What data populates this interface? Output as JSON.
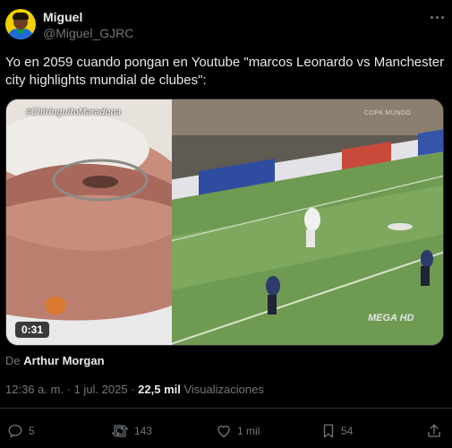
{
  "author": {
    "name": "Miguel",
    "handle": "@Miguel_GJRC"
  },
  "tweet": {
    "text": "Yo en 2059 cuando pongan en Youtube \"marcos Leonardo vs Manchester city highlights mundial de clubes\":"
  },
  "media": {
    "hashtag": "#ChiringuitoMaradona",
    "watermark_top": "COPA MUNDO",
    "watermark_logo": "MEGA HD",
    "duration": "0:31"
  },
  "source": {
    "prefix": "De",
    "name": "Arthur Morgan"
  },
  "meta": {
    "timestamp": "12:36 a. m. · 1 jul. 2025 ·",
    "views_count": "22,5 mil",
    "views_label": "Visualizaciones"
  },
  "actions": {
    "replies": "5",
    "reposts": "143",
    "likes": "1 mil",
    "bookmarks": "54"
  },
  "colors": {
    "background": "#000000",
    "text": "#e7e9ea",
    "secondary": "#71767b",
    "border": "#2f3336"
  }
}
